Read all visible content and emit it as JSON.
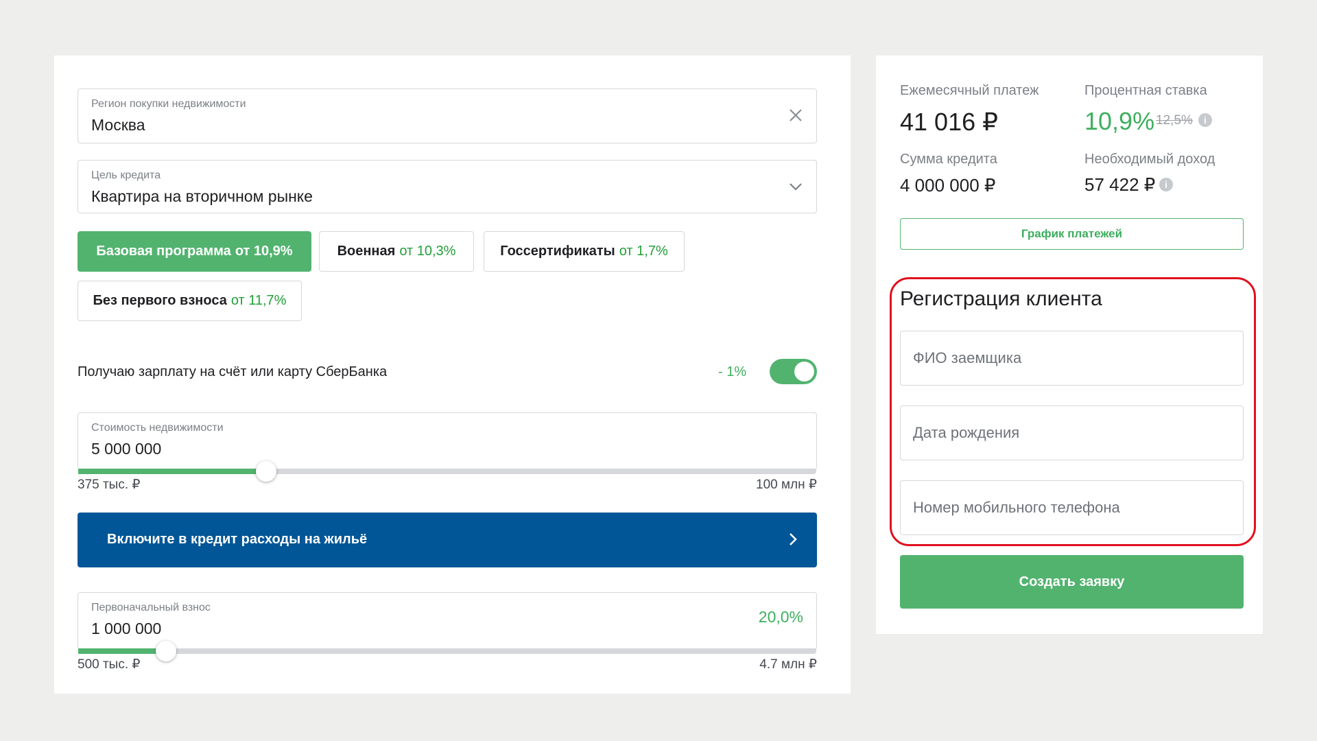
{
  "left": {
    "region": {
      "label": "Регион покупки недвижимости",
      "value": "Москва"
    },
    "purpose": {
      "label": "Цель кредита",
      "value": "Квартира на вторичном рынке"
    },
    "programs": [
      {
        "name": "Базовая программа",
        "rate": "от 10,9%",
        "active": true
      },
      {
        "name": "Военная",
        "rate": "от 10,3%",
        "active": false
      },
      {
        "name": "Госсертификаты",
        "rate": "от 1,7%",
        "active": false
      },
      {
        "name": "Без первого взноса",
        "rate": "от 11,7%",
        "active": false
      }
    ],
    "salary": {
      "label": "Получаю зарплату на счёт или карту СберБанка",
      "discount": "- 1%",
      "enabled": true
    },
    "property_cost": {
      "label": "Стоимость недвижимости",
      "value": "5 000 000",
      "min_label": "375 тыс. ₽",
      "max_label": "100 млн ₽",
      "slider_fraction": 0.255
    },
    "promo": {
      "text": "Включите в кредит расходы на жильё"
    },
    "down_payment": {
      "label": "Первоначальный взнос",
      "value": "1 000 000",
      "percent": "20,0%",
      "min_label": "500 тыс. ₽",
      "max_label": "4.7 млн ₽",
      "slider_fraction": 0.119
    }
  },
  "right": {
    "monthly_payment": {
      "label": "Ежемесячный платеж",
      "value": "41 016 ₽"
    },
    "interest_rate": {
      "label": "Процентная ставка",
      "value": "10,9%",
      "old_value": "12,5%"
    },
    "loan_amount": {
      "label": "Сумма кредита",
      "value": "4 000 000 ₽"
    },
    "required_income": {
      "label": "Необходимый доход",
      "value": "57 422 ₽"
    },
    "schedule_button": "График платежей",
    "registration": {
      "title": "Регистрация клиента",
      "name_placeholder": "ФИО заемщика",
      "birth_placeholder": "Дата рождения",
      "phone_placeholder": "Номер мобильного телефона"
    },
    "submit_button": "Создать заявку"
  },
  "colors": {
    "accent_green": "#52b36f",
    "text_green": "#3dae5d",
    "promo_blue": "#015697",
    "highlight_red": "#e0101d"
  },
  "icons": {
    "clear": "close-icon",
    "dropdown": "chevron-down-icon",
    "promo_arrow": "chevron-right-icon",
    "info": "info-icon"
  }
}
